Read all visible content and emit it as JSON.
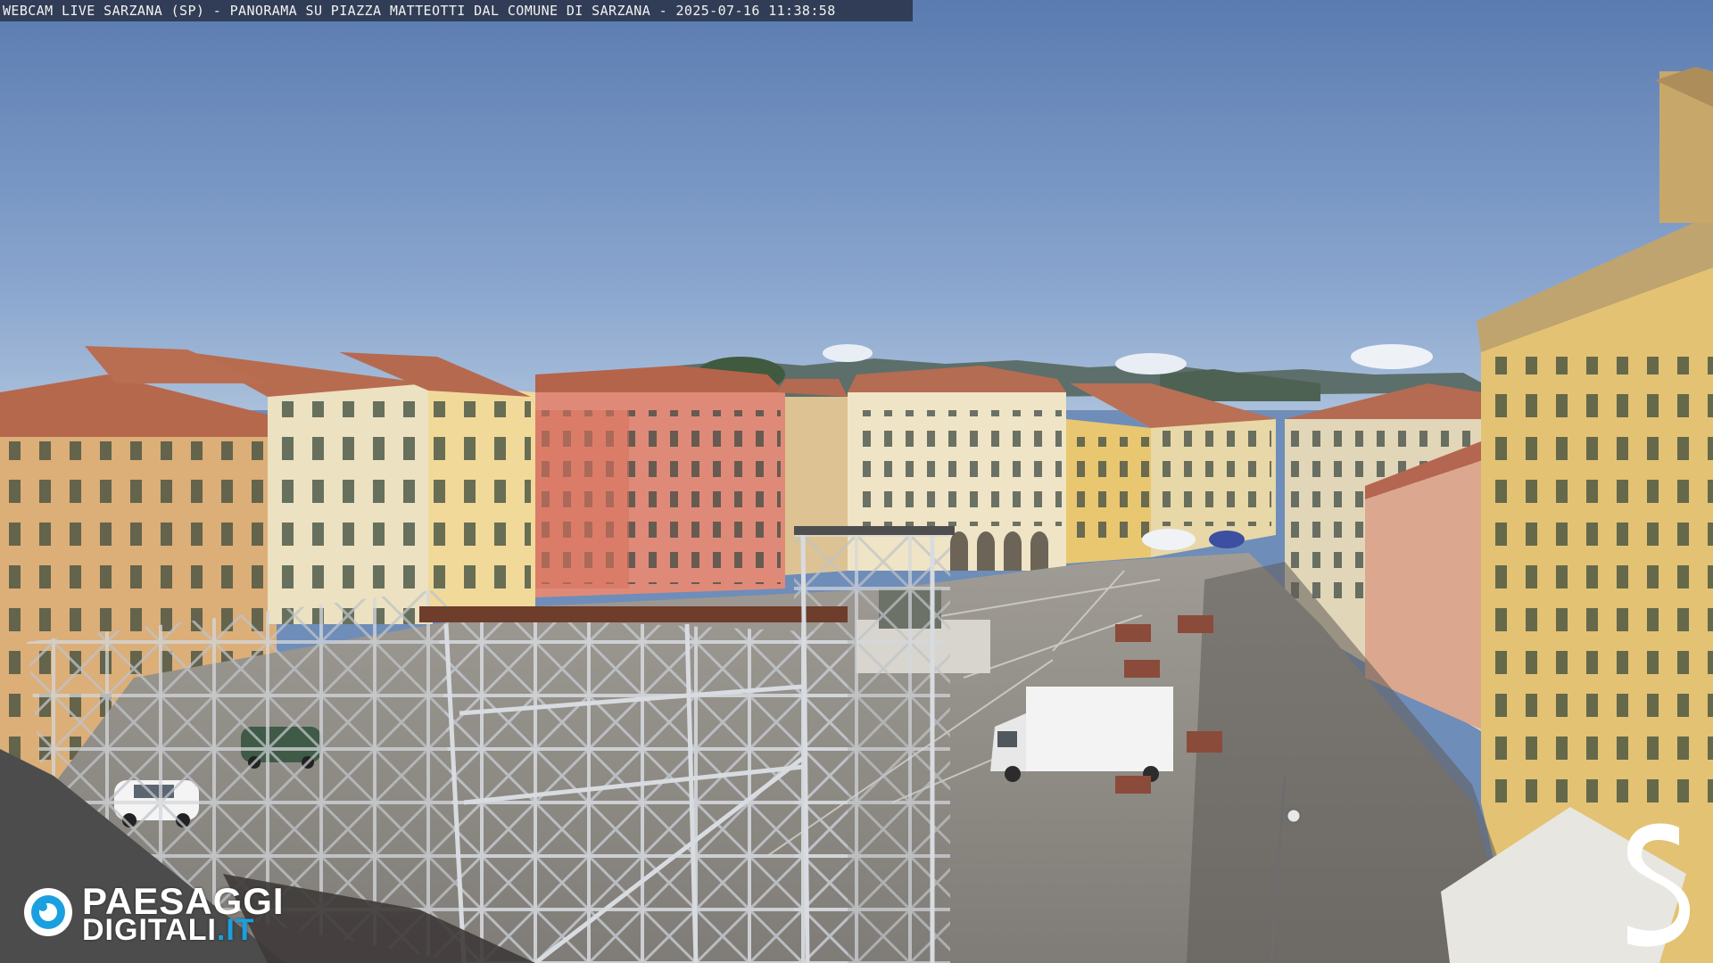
{
  "caption": {
    "text": "WEBCAM LIVE SARZANA (SP) - PANORAMA SU PIAZZA MATTEOTTI DAL COMUNE DI SARZANA - 2025-07-16  11:38:58"
  },
  "watermark_left": {
    "line1": "PAESAGGI",
    "line2_main": "DIGITALI",
    "line2_tld": ".IT",
    "icon": "camera-lens-icon",
    "accent_color": "#1aa0e0"
  },
  "watermark_right": {
    "icon": "s-monogram-icon",
    "letter": "S"
  },
  "colors": {
    "sky_top": "#5f7fb1",
    "sky_horizon": "#9fb8d6",
    "piazza_pavement": "#8e8c88",
    "roof_terracotta": "#b56a4f",
    "facade_pink": "#d8806f",
    "facade_yellow": "#e6c98a",
    "facade_cream": "#ece3c8",
    "scaffold_steel": "#c9ccd0"
  }
}
